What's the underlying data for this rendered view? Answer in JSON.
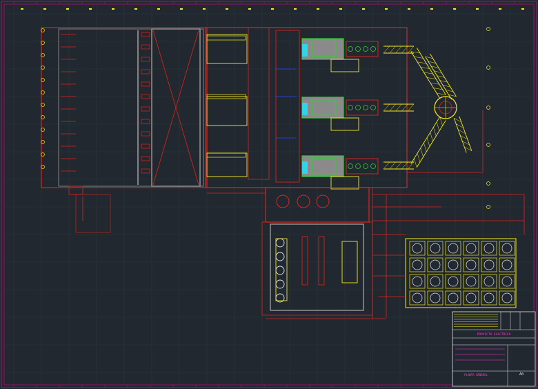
{
  "colors": {
    "background": "#212830",
    "grid": "#2b343d",
    "border": "#b0107a",
    "wall": "#e2231a",
    "equipment": "#f6ec1b",
    "pipe_green": "#39c93a",
    "cyan": "#2fd4e6",
    "blue": "#2747ff",
    "white": "#e6e6e6",
    "gray": "#9a9a9a",
    "magenta": "#ff3bd4"
  },
  "title_block": {
    "project_line": "PROYECTO ELECTRICO",
    "description_line": "PLANTA GENERAL",
    "sheet_number": "A0"
  }
}
